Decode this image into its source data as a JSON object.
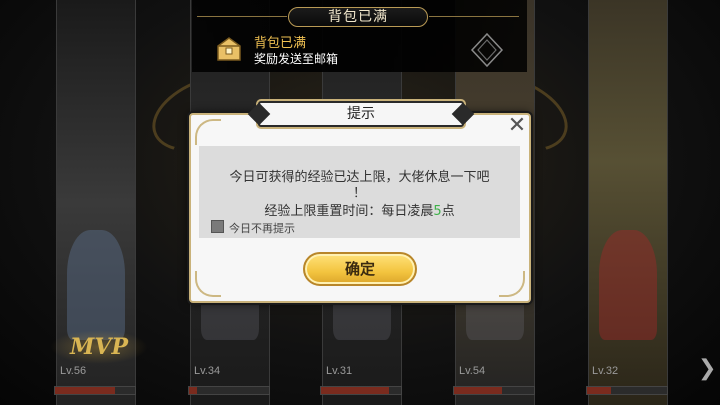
{
  "top_notification": {
    "header": "背包已满",
    "title": "背包已满",
    "subtitle": "奖励发送至邮箱"
  },
  "dialog": {
    "title": "提示",
    "line1": "今日可获得的经验已达上限，大佬休息一下吧",
    "line2": "！",
    "line3_prefix": "经验上限重置时间：每日凌晨",
    "line3_hour": "5",
    "line3_suffix": "点",
    "checkbox_label": "今日不再提示",
    "confirm_label": "确定"
  },
  "characters": [
    {
      "level": "Lv.56",
      "exp": 0.75
    },
    {
      "level": "Lv.34",
      "exp": 0.1
    },
    {
      "level": "Lv.31",
      "exp": 0.85
    },
    {
      "level": "Lv.54",
      "exp": 0.6
    },
    {
      "level": "Lv.32",
      "exp": 0.3
    }
  ],
  "mvp_badge": "MVP",
  "colors": {
    "accent_gold": "#f0c152",
    "highlight_green": "#3fb24a",
    "exp_bar": "#7a2b1e"
  },
  "icons": {
    "reward": "treasure-chest-icon",
    "close": "close-icon",
    "nav": "chevron-right-icon",
    "diamond": "diamond-icon"
  }
}
